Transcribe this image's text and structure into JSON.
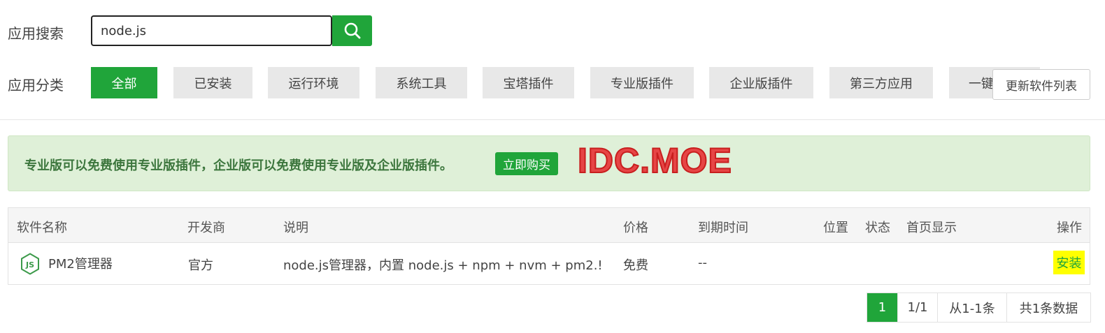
{
  "search": {
    "label": "应用搜索",
    "value": "node.js"
  },
  "categories": {
    "label": "应用分类",
    "items": [
      "全部",
      "已安装",
      "运行环境",
      "系统工具",
      "宝塔插件",
      "专业版插件",
      "企业版插件",
      "第三方应用",
      "一键"
    ],
    "active_index": 0
  },
  "update_button": "更新软件列表",
  "promo": {
    "text": "专业版可以免费使用专业版插件，企业版可以免费使用专业版及企业版插件。",
    "buy_label": "立即购买",
    "watermark": "IDC.MOE"
  },
  "table": {
    "headers": [
      "软件名称",
      "开发商",
      "说明",
      "价格",
      "到期时间",
      "位置",
      "状态",
      "首页显示",
      "操作"
    ],
    "rows": [
      {
        "name": "PM2管理器",
        "icon": "nodejs-icon",
        "developer": "官方",
        "description": "node.js管理器，内置 node.js + npm + nvm + pm2.!",
        "price": "免费",
        "expiry": "--",
        "action": "安装"
      }
    ]
  },
  "pagination": {
    "current": "1",
    "pages": "1/1",
    "range": "从1-1条",
    "total": "共1条数据"
  },
  "colors": {
    "accent": "#20a53a",
    "promo_bg": "#dff0d8",
    "promo_text": "#3c763d",
    "highlight": "#ffff00"
  }
}
